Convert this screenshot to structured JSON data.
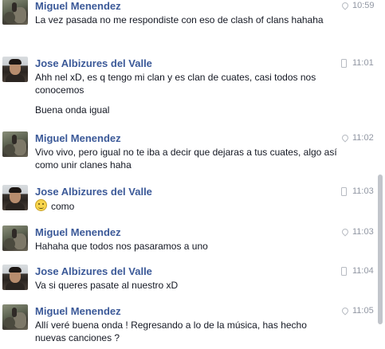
{
  "messages": [
    {
      "sender": "Miguel Menendez",
      "time": "10:59",
      "source_icon": "location-pin-icon",
      "avatar": "miguel",
      "lines": [
        "La vez pasada no me respondiste con eso de clash of clans hahaha"
      ]
    },
    {
      "sender": "Jose Albizures del Valle",
      "time": "11:01",
      "source_icon": "phone-icon",
      "avatar": "jose",
      "lines": [
        "Ahh nel xD, es q tengo mi clan y es clan de cuates, casi todos nos conocemos",
        "Buena onda igual"
      ]
    },
    {
      "sender": "Miguel Menendez",
      "time": "11:02",
      "source_icon": "location-pin-icon",
      "avatar": "miguel",
      "lines": [
        "Vivo vivo, pero igual no te iba a decir que dejaras a tus cuates, algo así como unir clanes haha"
      ]
    },
    {
      "sender": "Jose Albizures del Valle",
      "time": "11:03",
      "source_icon": "phone-icon",
      "avatar": "jose",
      "lines": [
        "como"
      ],
      "emoji": "smiley-emoji-icon"
    },
    {
      "sender": "Miguel Menendez",
      "time": "11:03",
      "source_icon": "location-pin-icon",
      "avatar": "miguel",
      "lines": [
        "Hahaha que todos nos pasaramos a uno"
      ]
    },
    {
      "sender": "Jose Albizures del Valle",
      "time": "11:04",
      "source_icon": "phone-icon",
      "avatar": "jose",
      "lines": [
        "Va si queres pasate al nuestro xD"
      ]
    },
    {
      "sender": "Miguel Menendez",
      "time": "11:05",
      "source_icon": "location-pin-icon",
      "avatar": "miguel",
      "lines": [
        "Allí veré buena onda ! Regresando a lo de la música, has hecho nuevas canciones ?"
      ]
    }
  ],
  "colors": {
    "sender_name": "#3b5998",
    "message_text": "#141823",
    "timestamp": "#9197a3"
  }
}
